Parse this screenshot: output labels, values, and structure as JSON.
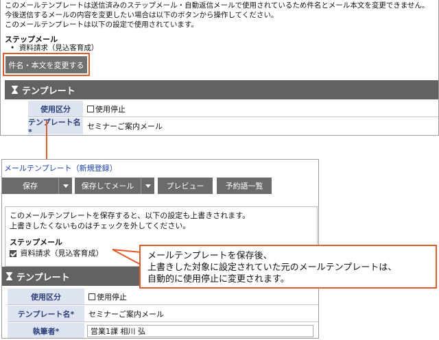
{
  "panel1": {
    "notice_lines": [
      "このメールテンプレートは送信済みのステップメール・自動返信メールで使用されているため件名とメール本文を変更できません。",
      "今後送信するメールの内容を変更したい場合は以下のボタンから操作してください。",
      "このメールテンプレートは以下の設定で使用されています。"
    ],
    "step_mail_label": "ステップメール",
    "step_mail_item": "資料請求（見込客育成）",
    "change_button_label": "件名・本文を変更する",
    "section_title": "テンプレート",
    "rows": [
      {
        "label": "使用区分",
        "value": "使用停止"
      },
      {
        "label": "テンプレート名*",
        "value": "セミナーご案内メール"
      }
    ]
  },
  "panel2": {
    "page_title": "メールテンプレート（新規登録）",
    "toolbar": {
      "save": "保存",
      "save_and_mail": "保存してメール",
      "preview": "プレビュー",
      "reserved_words": "予約語一覧"
    },
    "notice_lines": [
      "このメールテンプレートを保存すると、以下の設定も上書きされます。",
      "上書きしたくないものはチェックを外してください。"
    ],
    "step_mail_label": "ステップメール",
    "step_mail_checkbox_label": "資料請求（見込客育成）",
    "section_title": "テンプレート",
    "rows": [
      {
        "label": "使用区分",
        "value": "使用停止"
      },
      {
        "label": "テンプレート名*",
        "value": "セミナーご案内メール"
      },
      {
        "label": "執筆者*",
        "value": "営業1課 相川 弘"
      }
    ]
  },
  "callout": {
    "lines": [
      "メールテンプレートを保存後、",
      "上書きした対象に設定されていた元のメールテンプレートは、",
      "自動的に使用停止に変更されます。"
    ]
  },
  "colors": {
    "highlight": "#e05a2b",
    "button_gray": "#6b6b6b",
    "header_gray": "#626262",
    "label_bg": "#dde3f0",
    "label_text": "#2a3e78",
    "link": "#1a3fa3"
  }
}
